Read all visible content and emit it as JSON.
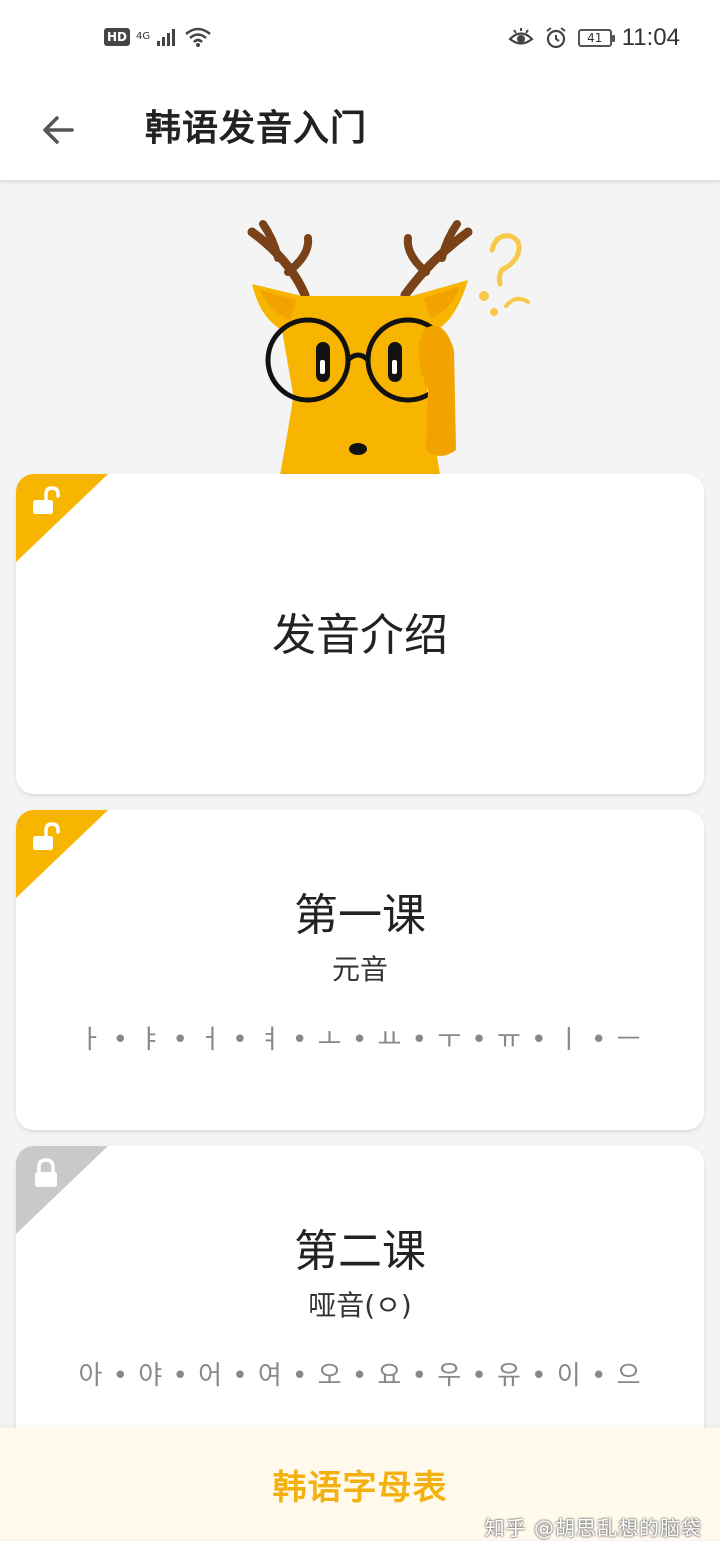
{
  "status_bar": {
    "hd": "HD",
    "network": "4G",
    "battery": "41",
    "time": "11:04"
  },
  "app_bar": {
    "title": "韩语发音入门"
  },
  "lessons": [
    {
      "title": "发音介绍",
      "subtitle": "",
      "letters": "",
      "locked": false
    },
    {
      "title": "第一课",
      "subtitle": "元音",
      "letters": "ㅏ • ㅑ • ㅓ • ㅕ • ㅗ • ㅛ • ㅜ • ㅠ • ㅣ • ㅡ",
      "locked": false
    },
    {
      "title": "第二课",
      "subtitle": "哑音(ㅇ)",
      "letters": "아 • 야 • 어 • 여 • 오 • 요 • 우 • 유 • 이 • 으",
      "locked": true
    }
  ],
  "bottom_button": {
    "label": "韩语字母表"
  },
  "watermark": "知乎 @胡思乱想的脑袋",
  "colors": {
    "accent": "#f4b00d",
    "unlocked_corner": "#f7b500",
    "locked_corner": "#c9c9c9",
    "bottom_bar_bg": "#fffaec"
  },
  "icons": {
    "back": "arrow-left-icon",
    "unlocked": "lock-open-icon",
    "locked": "lock-closed-icon",
    "mascot": "deer-mascot"
  }
}
